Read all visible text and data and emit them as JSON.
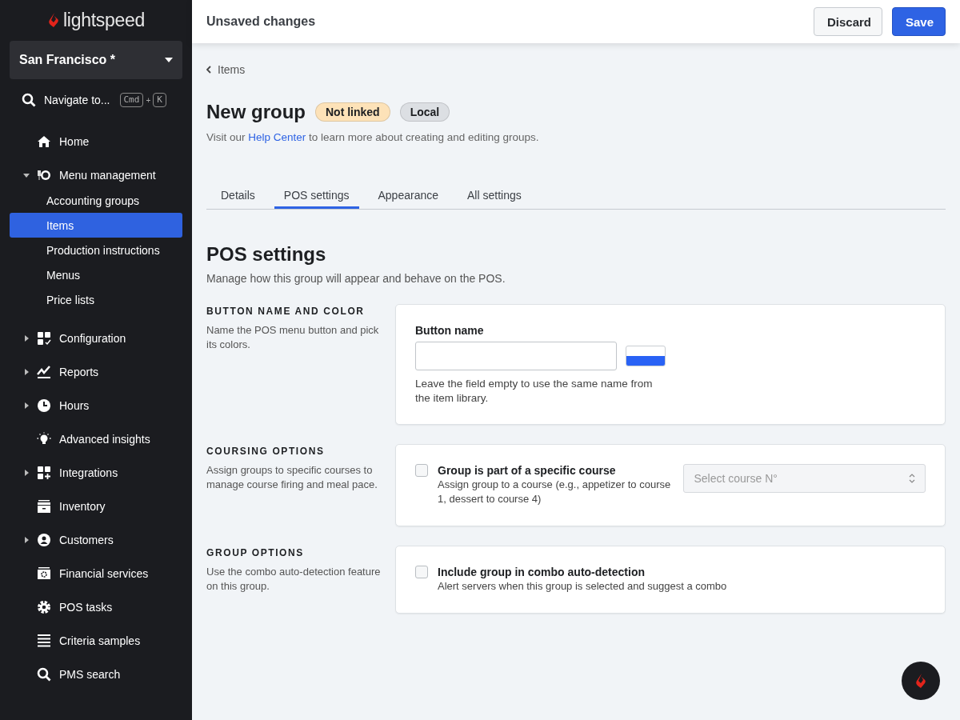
{
  "sidebar": {
    "brand": "lightspeed",
    "location": "San Francisco *",
    "navigate": {
      "label": "Navigate to...",
      "keys": [
        "Cmd",
        "K"
      ],
      "joiner": "+"
    },
    "items": [
      {
        "label": "Home",
        "kind": "home"
      },
      {
        "label": "Menu management",
        "kind": "menu",
        "expanded": true,
        "children": [
          {
            "label": "Accounting groups",
            "selected": false
          },
          {
            "label": "Items",
            "selected": true
          },
          {
            "label": "Production instructions",
            "selected": false
          },
          {
            "label": "Menus",
            "selected": false
          },
          {
            "label": "Price lists",
            "selected": false
          }
        ]
      },
      {
        "label": "Configuration",
        "kind": "config",
        "expanded": false
      },
      {
        "label": "Reports",
        "kind": "reports",
        "expanded": false
      },
      {
        "label": "Hours",
        "kind": "hours",
        "expanded": false
      },
      {
        "label": "Advanced insights",
        "kind": "insights"
      },
      {
        "label": "Integrations",
        "kind": "integrations",
        "expanded": false
      },
      {
        "label": "Inventory",
        "kind": "inventory"
      },
      {
        "label": "Customers",
        "kind": "customers",
        "expanded": false
      },
      {
        "label": "Financial services",
        "kind": "financial"
      },
      {
        "label": "POS tasks",
        "kind": "tasks"
      },
      {
        "label": "Criteria samples",
        "kind": "criteria"
      },
      {
        "label": "PMS search",
        "kind": "search"
      }
    ]
  },
  "topbar": {
    "title": "Unsaved changes",
    "buttons": [
      {
        "label": "Discard",
        "kind": "secondary"
      },
      {
        "label": "Save",
        "kind": "primary"
      }
    ]
  },
  "breadcrumb": "Items",
  "page": {
    "title": "New group",
    "badges": [
      {
        "label": "Not linked",
        "color": "#fde2b8"
      },
      {
        "label": "Local",
        "color": "#dcdfe3"
      }
    ],
    "help": {
      "before": "Visit our",
      "link": "Help Center",
      "after": "to learn more about creating and editing groups."
    }
  },
  "tabs": [
    {
      "label": "Details",
      "selected": false
    },
    {
      "label": "POS settings",
      "selected": true
    },
    {
      "label": "Appearance",
      "selected": false
    },
    {
      "label": "All settings",
      "selected": false
    }
  ],
  "section": {
    "title": "POS settings",
    "subtitle": "Manage how this group will appear and behave on the POS.",
    "groups": [
      {
        "kind": "name_color",
        "heading": "BUTTON NAME AND COLOR",
        "description": "Name the POS menu button and pick its colors.",
        "field_label": "Button name",
        "swatch": {
          "color": "#2962f5"
        },
        "hint": "Leave the field empty to use the same name from the item library."
      },
      {
        "kind": "checkbox",
        "heading": "COURSING OPTIONS",
        "description": "Assign groups to specific courses to manage course firing and meal pace.",
        "checked": false,
        "label": "Group is part of a specific course",
        "detail": "Assign group to a course (e.g., appetizer to course 1, dessert to course 4)",
        "select": {
          "placeholder": "Select course N°"
        }
      },
      {
        "kind": "checkbox",
        "heading": "GROUP OPTIONS",
        "description": "Use the combo auto-detection feature on this group.",
        "checked": false,
        "label": "Include group in combo auto-detection",
        "detail": "Alert servers when this group is selected and suggest a combo"
      }
    ]
  }
}
